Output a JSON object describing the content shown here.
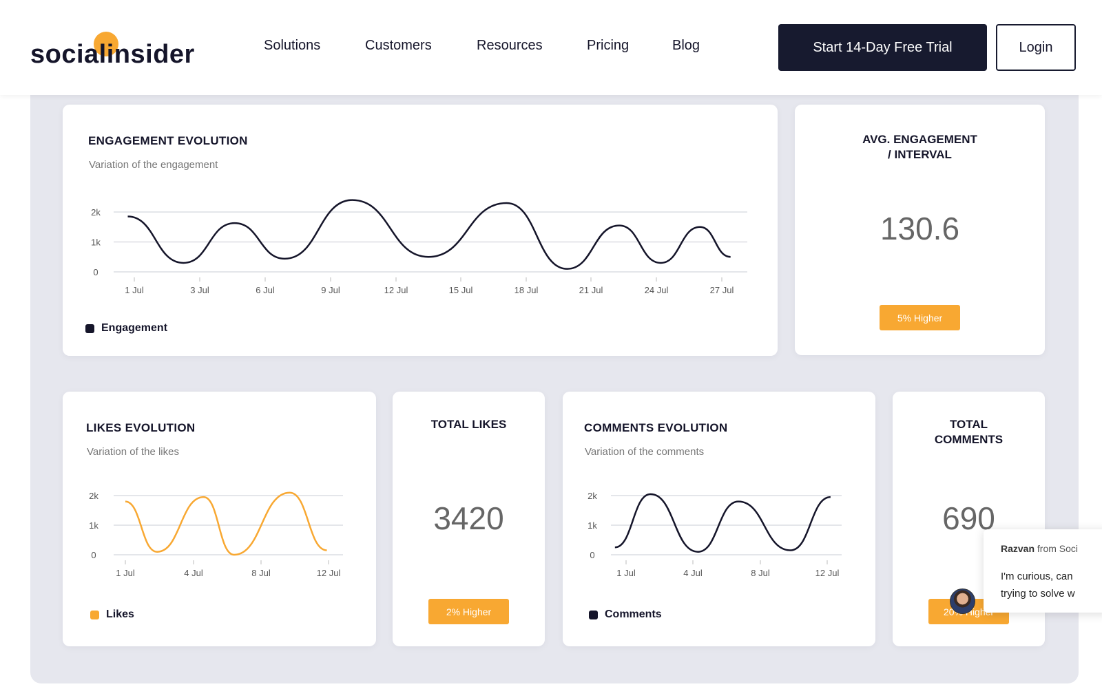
{
  "header": {
    "logo": "socialinsider",
    "nav": [
      "Solutions",
      "Customers",
      "Resources",
      "Pricing",
      "Blog"
    ],
    "trial_button": "Start 14-Day Free Trial",
    "login_button": "Login",
    "accent": "#f8a832",
    "dark": "#171a2f"
  },
  "engagement": {
    "title": "ENGAGEMENT EVOLUTION",
    "subtitle": "Variation of the engagement",
    "legend": "Engagement"
  },
  "avg": {
    "title_line1": "AVG. ENGAGEMENT",
    "title_line2": "/ INTERVAL",
    "value": "130.6",
    "badge": "5% Higher"
  },
  "likes": {
    "title": "LIKES EVOLUTION",
    "subtitle": "Variation of the likes",
    "legend": "Likes"
  },
  "total_likes": {
    "title": "TOTAL LIKES",
    "value": "3420",
    "badge": "2% Higher"
  },
  "comments": {
    "title": "COMMENTS EVOLUTION",
    "subtitle": "Variation of the comments",
    "legend": "Comments"
  },
  "total_comments": {
    "title_line1": "TOTAL",
    "title_line2": "COMMENTS",
    "value": "690",
    "badge": "20% Higher"
  },
  "chat": {
    "name": "Razvan",
    "from": "from Soci",
    "line1": "I'm curious, can",
    "line2": "trying to solve w"
  },
  "chart_data": [
    {
      "type": "line",
      "series": [
        {
          "name": "Engagement",
          "color": "#15152a",
          "x": [
            0.8,
            2.5,
            4.6,
            6.9,
            10.0,
            13.5,
            17.1,
            19.9,
            22.3,
            24.2,
            26.0,
            27.4
          ],
          "y": [
            1850,
            300,
            1630,
            440,
            2400,
            500,
            2300,
            100,
            1550,
            300,
            1500,
            500
          ]
        }
      ],
      "xticks": [
        "1 Jul",
        "3 Jul",
        "6 Jul",
        "9 Jul",
        "12 Jul",
        "15 Jul",
        "18 Jul",
        "21 Jul",
        "24 Jul",
        "27 Jul"
      ],
      "xtick_days": [
        1,
        3,
        6,
        9,
        12,
        15,
        18,
        21,
        24,
        27
      ],
      "yticks": [
        "0",
        "1k",
        "2k"
      ],
      "ytick_values": [
        0,
        1000,
        2000
      ],
      "grid": true
    },
    {
      "type": "line",
      "series": [
        {
          "name": "Likes",
          "color": "#f8a832",
          "x": [
            1.0,
            2.4,
            4.6,
            6.4,
            9.7,
            11.9
          ],
          "y": [
            1800,
            100,
            1950,
            0,
            2100,
            150
          ]
        }
      ],
      "xticks": [
        "1 Jul",
        "4 Jul",
        "8 Jul",
        "12 Jul"
      ],
      "xtick_days": [
        1,
        4,
        8,
        12
      ],
      "yticks": [
        "0",
        "1k",
        "2k"
      ],
      "ytick_values": [
        0,
        1000,
        2000
      ],
      "grid": true
    },
    {
      "type": "line",
      "series": [
        {
          "name": "Comments",
          "color": "#15152a",
          "x": [
            0.5,
            2.1,
            4.3,
            6.7,
            9.8,
            12.2
          ],
          "y": [
            250,
            2050,
            100,
            1800,
            150,
            1950
          ]
        }
      ],
      "xticks": [
        "1 Jul",
        "4 Jul",
        "8 Jul",
        "12 Jul"
      ],
      "xtick_days": [
        1,
        4,
        8,
        12
      ],
      "yticks": [
        "0",
        "1k",
        "2k"
      ],
      "ytick_values": [
        0,
        1000,
        2000
      ],
      "grid": true
    }
  ]
}
